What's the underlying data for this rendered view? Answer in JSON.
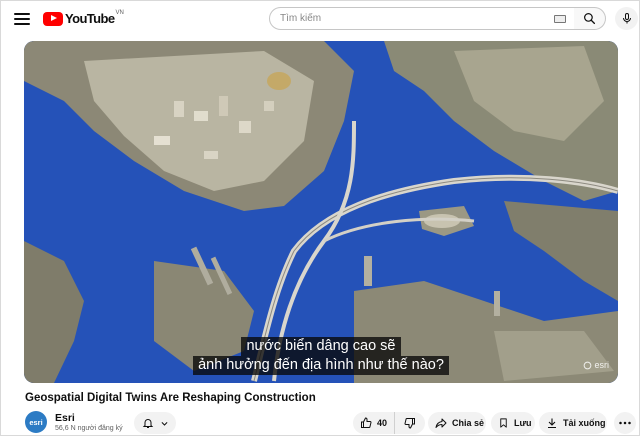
{
  "header": {
    "logo_text": "YouTube",
    "logo_country": "VN",
    "search_placeholder": "Tìm kiếm",
    "icons": [
      "menu-icon",
      "search-icon",
      "keyboard-icon",
      "microphone-icon"
    ]
  },
  "player": {
    "captions": [
      "nước biển dâng cao sẽ",
      "ảnh hưởng đến địa hình như thế nào?"
    ],
    "watermark": "esri",
    "colors": {
      "water": "#2a5bc4",
      "land": "#8f8b76",
      "city": "#c9c5b4"
    }
  },
  "video": {
    "title": "Geospatial Digital Twins Are Reshaping Construction"
  },
  "channel": {
    "avatar_text": "esri",
    "name": "Esri",
    "subscribers": "56,6 N người đăng ký"
  },
  "actions": {
    "like_count": "40",
    "share_label": "Chia sẻ",
    "save_label": "Lưu",
    "download_label": "Tải xuống"
  }
}
